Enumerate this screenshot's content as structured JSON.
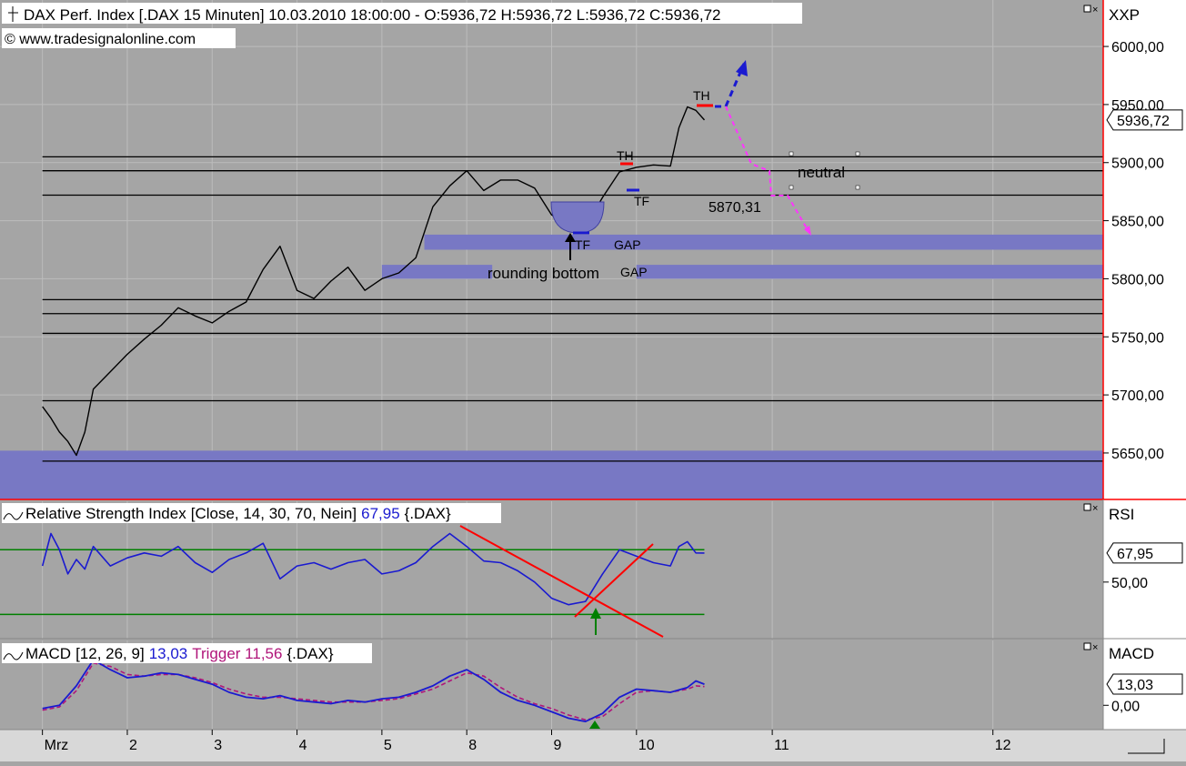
{
  "header": {
    "title": "DAX Perf. Index [.DAX  15 Minuten] 10.03.2010 18:00:00 - O:5936,72 H:5936,72 L:5936,72 C:5936,72",
    "copyright": "© www.tradesignalonline.com",
    "scale_label": "XXP"
  },
  "colors": {
    "background": "#a5a5a5",
    "zone": "#7878c4",
    "price_line": "#000000",
    "rsi_line": "#1a1ad0",
    "macd_line": "#1a1ad0",
    "trigger_line": "#b0157a",
    "band": "#008000",
    "trend": "#ff0000",
    "pink_arrow": "#ff33ff",
    "blue_arrow": "#1a1ad0"
  },
  "chart_data": [
    {
      "type": "line",
      "panel": "price",
      "title": "DAX Perf. Index [.DAX  15 Minuten] 10.03.2010 18:00:00 - O:5936,72 H:5936,72 L:5936,72 C:5936,72",
      "ylim": [
        5610,
        6040
      ],
      "y_ticks": [
        6000,
        5950,
        5900,
        5850,
        5800,
        5750,
        5700,
        5650
      ],
      "y_tick_labels": [
        "6000,00",
        "5950,00",
        "5900,00",
        "5850,00",
        "5800,00",
        "5750,00",
        "5700,00",
        "5650,00"
      ],
      "last_value_label": "5936,72",
      "x_ticks": [
        "Mrz",
        "2",
        "3",
        "4",
        "5",
        "8",
        "9",
        "10",
        "11",
        "12"
      ],
      "x_tick_positions": [
        0,
        1,
        2,
        3,
        4,
        5,
        6,
        7,
        8.6,
        11.2
      ],
      "xlim": [
        -0.5,
        12.5
      ],
      "series": [
        {
          "x": [
            0,
            0.1,
            0.2,
            0.3,
            0.4,
            0.5,
            0.6,
            0.8,
            1.0,
            1.2,
            1.4,
            1.6,
            1.8,
            2.0,
            2.2,
            2.4,
            2.6,
            2.8,
            3.0,
            3.2,
            3.4,
            3.6,
            3.8,
            4.0,
            4.2,
            4.4,
            4.6,
            4.8,
            5.0,
            5.2,
            5.4,
            5.6,
            5.8,
            6.0,
            6.2,
            6.4,
            6.6,
            6.8,
            7.0,
            7.2,
            7.4,
            7.5,
            7.6,
            7.7,
            7.8
          ],
          "y": [
            5690,
            5680,
            5668,
            5660,
            5648,
            5668,
            5705,
            5720,
            5735,
            5748,
            5760,
            5775,
            5768,
            5762,
            5772,
            5780,
            5808,
            5828,
            5790,
            5783,
            5798,
            5810,
            5790,
            5800,
            5805,
            5818,
            5862,
            5880,
            5893,
            5876,
            5885,
            5885,
            5878,
            5855,
            5845,
            5845,
            5870,
            5892,
            5896,
            5898,
            5897,
            5930,
            5948,
            5945,
            5936.72
          ]
        }
      ],
      "horizontal_lines": [
        5905,
        5893,
        5872,
        5782,
        5770,
        5753,
        5695,
        5643
      ],
      "zones": [
        {
          "from_x": 4.5,
          "to_x": 12.5,
          "low": 5825,
          "high": 5838
        },
        {
          "from_x": 4.0,
          "to_x": 5.3,
          "low": 5800,
          "high": 5812
        },
        {
          "from_x": 7.0,
          "to_x": 12.5,
          "low": 5800,
          "high": 5812
        },
        {
          "from_x": -0.5,
          "to_x": 12.5,
          "low": 5610,
          "high": 5652
        }
      ],
      "annotations": {
        "th1": "TH",
        "th2": "TH",
        "tf1": "TF",
        "tf2": "TF",
        "gap1": "GAP",
        "gap2": "GAP",
        "rounding": "rounding bottom",
        "neutral": "neutral",
        "level": "5870,31"
      }
    },
    {
      "type": "line",
      "panel": "rsi",
      "title_name": "Relative Strength Index",
      "title_params": "[Close, 14, 30, 70, Nein]",
      "title_value": "67,95",
      "title_symbol": "{.DAX}",
      "scale_label": "RSI",
      "ylim": [
        15,
        100
      ],
      "y_ticks": [
        50
      ],
      "y_tick_labels": [
        "50,00"
      ],
      "last_value_label": "67,95",
      "bands": [
        70,
        30
      ],
      "series": [
        {
          "x": [
            0,
            0.1,
            0.2,
            0.3,
            0.4,
            0.5,
            0.6,
            0.8,
            1.0,
            1.2,
            1.4,
            1.6,
            1.8,
            2.0,
            2.2,
            2.4,
            2.6,
            2.8,
            3.0,
            3.2,
            3.4,
            3.6,
            3.8,
            4.0,
            4.2,
            4.4,
            4.6,
            4.8,
            5.0,
            5.2,
            5.4,
            5.6,
            5.8,
            6.0,
            6.2,
            6.4,
            6.6,
            6.8,
            7.0,
            7.2,
            7.4,
            7.5,
            7.6,
            7.7,
            7.8
          ],
          "y": [
            60,
            80,
            70,
            55,
            64,
            58,
            72,
            60,
            65,
            68,
            66,
            72,
            62,
            56,
            64,
            68,
            74,
            52,
            60,
            62,
            58,
            62,
            64,
            55,
            57,
            62,
            72,
            80,
            72,
            63,
            62,
            57,
            50,
            40,
            36,
            38,
            55,
            70,
            66,
            62,
            60,
            72,
            75,
            68,
            67.95
          ]
        }
      ],
      "annotations": {}
    },
    {
      "type": "line",
      "panel": "macd",
      "title_name": "MACD",
      "title_params": "[12, 26, 9]",
      "title_value": "13,03",
      "title_trigger": "Trigger 11,56",
      "title_symbol": "{.DAX}",
      "scale_label": "MACD",
      "ylim": [
        -15,
        40
      ],
      "y_ticks": [
        0
      ],
      "y_tick_labels": [
        "0,00"
      ],
      "last_value_label": "13,03",
      "series": [
        {
          "name": "MACD",
          "x": [
            0,
            0.2,
            0.4,
            0.6,
            0.8,
            1.0,
            1.2,
            1.4,
            1.6,
            1.8,
            2.0,
            2.2,
            2.4,
            2.6,
            2.8,
            3.0,
            3.2,
            3.4,
            3.6,
            3.8,
            4.0,
            4.2,
            4.4,
            4.6,
            4.8,
            5.0,
            5.2,
            5.4,
            5.6,
            5.8,
            6.0,
            6.2,
            6.4,
            6.6,
            6.8,
            7.0,
            7.2,
            7.4,
            7.6,
            7.7,
            7.8
          ],
          "y": [
            -2,
            0,
            12,
            28,
            22,
            17,
            18,
            20,
            19,
            16,
            13,
            8,
            5,
            4,
            6,
            3,
            2,
            1,
            3,
            2,
            4,
            5,
            8,
            12,
            18,
            22,
            16,
            8,
            3,
            0,
            -4,
            -8,
            -10,
            -5,
            5,
            10,
            9,
            8,
            11,
            15,
            13.03
          ]
        },
        {
          "name": "Trigger",
          "x": [
            0,
            0.2,
            0.4,
            0.6,
            0.8,
            1.0,
            1.2,
            1.4,
            1.6,
            1.8,
            2.0,
            2.2,
            2.4,
            2.6,
            2.8,
            3.0,
            3.2,
            3.4,
            3.6,
            3.8,
            4.0,
            4.2,
            4.4,
            4.6,
            4.8,
            5.0,
            5.2,
            5.4,
            5.6,
            5.8,
            6.0,
            6.2,
            6.4,
            6.6,
            6.8,
            7.0,
            7.2,
            7.4,
            7.6,
            7.7,
            7.8
          ],
          "y": [
            -3,
            -1,
            9,
            26,
            24,
            19,
            18,
            19,
            19,
            17,
            14,
            10,
            7,
            5,
            5,
            4,
            3,
            2,
            2,
            2,
            3,
            4,
            7,
            10,
            15,
            20,
            18,
            11,
            5,
            1,
            -2,
            -6,
            -9,
            -7,
            1,
            8,
            9,
            8,
            10,
            12,
            11.56
          ]
        }
      ]
    }
  ]
}
